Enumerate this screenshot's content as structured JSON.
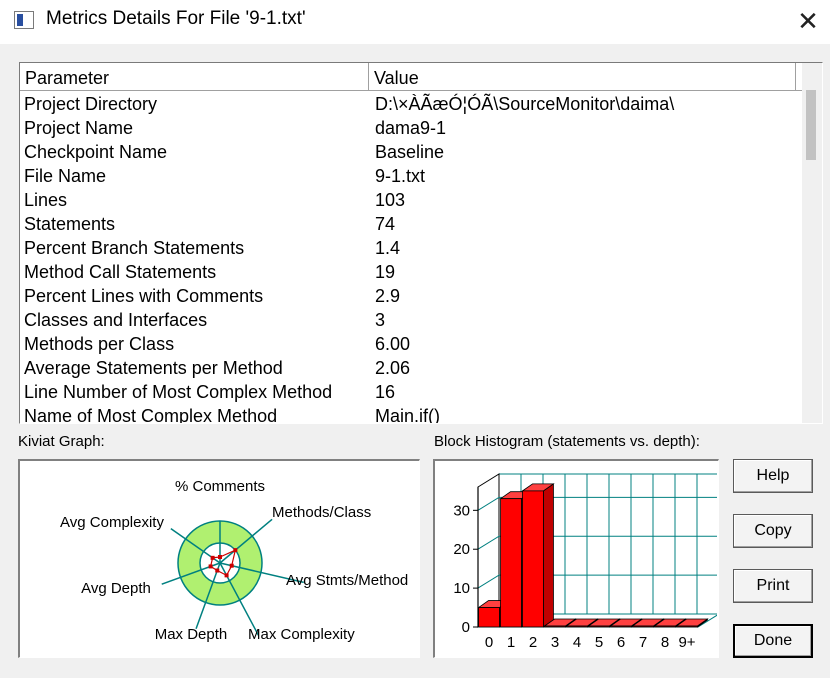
{
  "window": {
    "title": "Metrics Details For File '9-1.txt'",
    "close_glyph": "✕"
  },
  "table": {
    "columns": [
      "Parameter",
      "Value"
    ],
    "rows": [
      {
        "param": "Project Directory",
        "value": "D:\\×ÀÃæÓ¦ÓÃ\\SourceMonitor\\daima\\"
      },
      {
        "param": "Project Name",
        "value": "dama9-1"
      },
      {
        "param": "Checkpoint Name",
        "value": "Baseline"
      },
      {
        "param": "File Name",
        "value": "9-1.txt"
      },
      {
        "param": "Lines",
        "value": "103"
      },
      {
        "param": "Statements",
        "value": "74"
      },
      {
        "param": "Percent Branch Statements",
        "value": "1.4"
      },
      {
        "param": "Method Call Statements",
        "value": "19"
      },
      {
        "param": "Percent Lines with Comments",
        "value": "2.9"
      },
      {
        "param": "Classes and Interfaces",
        "value": "3"
      },
      {
        "param": "Methods per Class",
        "value": "6.00"
      },
      {
        "param": "Average Statements per Method",
        "value": "2.06"
      },
      {
        "param": "Line Number of Most Complex Method",
        "value": "16"
      },
      {
        "param": "Name of Most Complex Method",
        "value": "Main.if()"
      }
    ]
  },
  "kiviat": {
    "label": "Kiviat Graph:",
    "axes": [
      "% Comments",
      "Methods/Class",
      "Avg Stmts/Method",
      "Max Complexity",
      "Max Depth",
      "Avg Depth",
      "Avg Complexity"
    ]
  },
  "histogram": {
    "label": "Block Histogram (statements vs. depth):"
  },
  "chart_data": {
    "type": "bar",
    "title": "Block Histogram (statements vs. depth):",
    "categories": [
      "0",
      "1",
      "2",
      "3",
      "4",
      "5",
      "6",
      "7",
      "8",
      "9+"
    ],
    "values": [
      5,
      33,
      35,
      0,
      0,
      0,
      0,
      0,
      0,
      0
    ],
    "yticks": [
      0,
      10,
      20,
      30
    ],
    "ylim": [
      0,
      36
    ],
    "grid": true,
    "bar_color": "#ff0000"
  },
  "buttons": {
    "help": "Help",
    "copy": "Copy",
    "print": "Print",
    "done": "Done"
  },
  "colors": {
    "kiviat_ring": "#b0f070",
    "kiviat_axis": "#008080",
    "histogram_grid": "#008080",
    "bar": "#ff0000"
  }
}
